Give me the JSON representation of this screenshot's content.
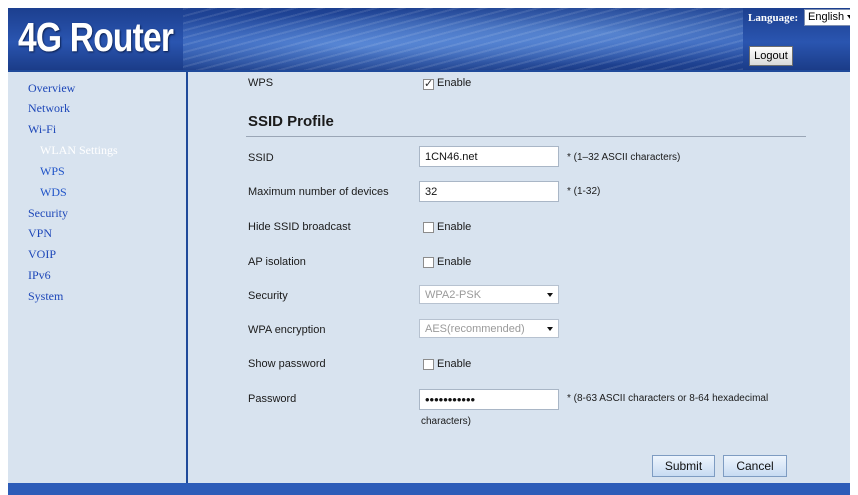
{
  "header": {
    "logo": "4G Router",
    "language_label": "Language:",
    "language_value": "English",
    "logout_label": "Logout"
  },
  "sidebar": {
    "items": [
      {
        "label": "Overview"
      },
      {
        "label": "Network"
      },
      {
        "label": "Wi-Fi"
      },
      {
        "label": "WLAN Settings",
        "active": true
      },
      {
        "label": "WPS"
      },
      {
        "label": "WDS"
      },
      {
        "label": "Security"
      },
      {
        "label": "VPN"
      },
      {
        "label": "VOIP"
      },
      {
        "label": "IPv6"
      },
      {
        "label": "System"
      }
    ]
  },
  "form": {
    "wps_label": "WPS",
    "wps_enable_text": "Enable",
    "wps_enabled": true,
    "section_title": "SSID Profile",
    "ssid_label": "SSID",
    "ssid_value": "1CN46.net",
    "ssid_hint": "* (1–32 ASCII characters)",
    "max_devices_label": "Maximum number of devices",
    "max_devices_value": "32",
    "max_devices_hint": "* (1-32)",
    "hide_ssid_label": "Hide SSID broadcast",
    "hide_ssid_enable_text": "Enable",
    "hide_ssid_enabled": false,
    "ap_isolation_label": "AP isolation",
    "ap_isolation_enable_text": "Enable",
    "ap_isolation_enabled": false,
    "security_label": "Security",
    "security_value": "WPA2-PSK",
    "wpa_encryption_label": "WPA encryption",
    "wpa_encryption_value": "AES(recommended)",
    "show_password_label": "Show password",
    "show_password_enable_text": "Enable",
    "show_password_enabled": false,
    "password_label": "Password",
    "password_value": "•••••••••••",
    "password_hint": "* (8-63 ASCII characters or 8-64 hexadecimal",
    "password_hint_cont": "characters)",
    "submit_label": "Submit",
    "cancel_label": "Cancel"
  },
  "colors": {
    "header_blue": "#1c3f8f",
    "panel_bg": "#d8e3ef",
    "nav_link": "#1c46b8",
    "nav_active": "#ffffff"
  }
}
